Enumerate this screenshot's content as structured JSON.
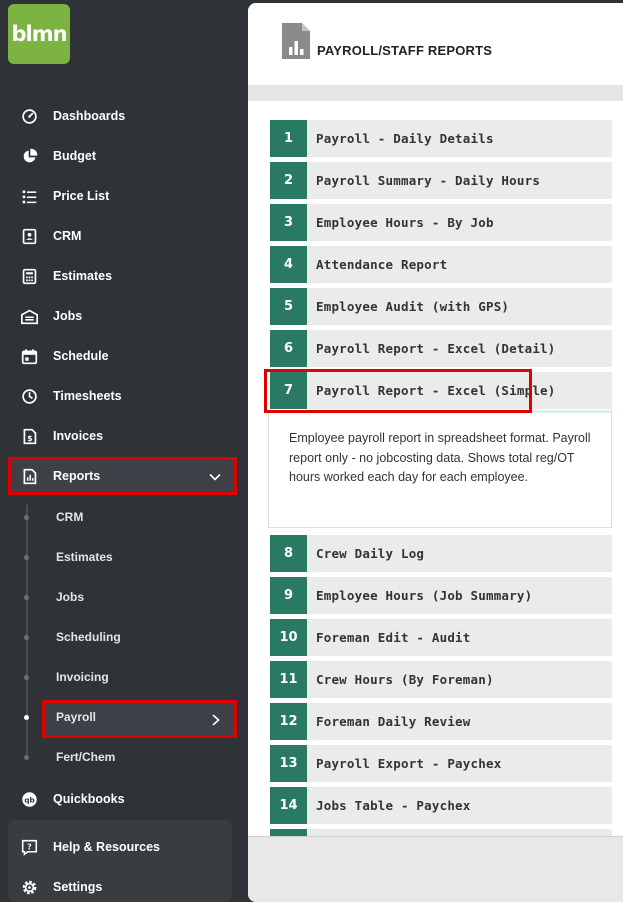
{
  "logo": {
    "text": "blmn"
  },
  "sidebar": {
    "items": [
      {
        "label": "Dashboards",
        "icon": "dashboard-icon"
      },
      {
        "label": "Budget",
        "icon": "pie-chart-icon"
      },
      {
        "label": "Price List",
        "icon": "list-icon"
      },
      {
        "label": "CRM",
        "icon": "contact-card-icon"
      },
      {
        "label": "Estimates",
        "icon": "calculator-icon"
      },
      {
        "label": "Jobs",
        "icon": "warehouse-icon"
      },
      {
        "label": "Schedule",
        "icon": "calendar-icon"
      },
      {
        "label": "Timesheets",
        "icon": "clock-icon"
      },
      {
        "label": "Invoices",
        "icon": "invoice-icon"
      },
      {
        "label": "Reports",
        "icon": "report-icon"
      }
    ],
    "reports_sub": [
      {
        "label": "CRM"
      },
      {
        "label": "Estimates"
      },
      {
        "label": "Jobs"
      },
      {
        "label": "Scheduling"
      },
      {
        "label": "Invoicing"
      },
      {
        "label": "Payroll"
      },
      {
        "label": "Fert/Chem"
      }
    ],
    "bottom_items": [
      {
        "label": "Quickbooks",
        "icon": "quickbooks-icon"
      },
      {
        "label": "Help & Resources",
        "icon": "help-icon"
      },
      {
        "label": "Settings",
        "icon": "gear-icon"
      }
    ]
  },
  "header": {
    "title": "PAYROLL/STAFF REPORTS"
  },
  "reports": [
    {
      "num": "1",
      "name": "Payroll - Daily Details"
    },
    {
      "num": "2",
      "name": "Payroll Summary - Daily Hours"
    },
    {
      "num": "3",
      "name": "Employee Hours - By Job"
    },
    {
      "num": "4",
      "name": "Attendance Report"
    },
    {
      "num": "5",
      "name": "Employee Audit (with GPS)"
    },
    {
      "num": "6",
      "name": "Payroll Report - Excel (Detail)"
    },
    {
      "num": "7",
      "name": "Payroll Report - Excel (Simple)"
    },
    {
      "num": "8",
      "name": "Crew Daily Log"
    },
    {
      "num": "9",
      "name": "Employee Hours (Job Summary)"
    },
    {
      "num": "10",
      "name": "Foreman Edit - Audit"
    },
    {
      "num": "11",
      "name": "Crew Hours (By Foreman)"
    },
    {
      "num": "12",
      "name": "Foreman Daily Review"
    },
    {
      "num": "13",
      "name": "Payroll Export - Paychex"
    },
    {
      "num": "14",
      "name": "Jobs Table - Paychex"
    }
  ],
  "selected_description": "Employee payroll report in spreadsheet format. Payroll report only - no jobcosting data. Shows total reg/OT hours worked each day for each employee.",
  "colors": {
    "accent": "#2a7a63",
    "logo": "#7cb342",
    "highlight": "#e00000",
    "sidebar": "#2f3237"
  }
}
